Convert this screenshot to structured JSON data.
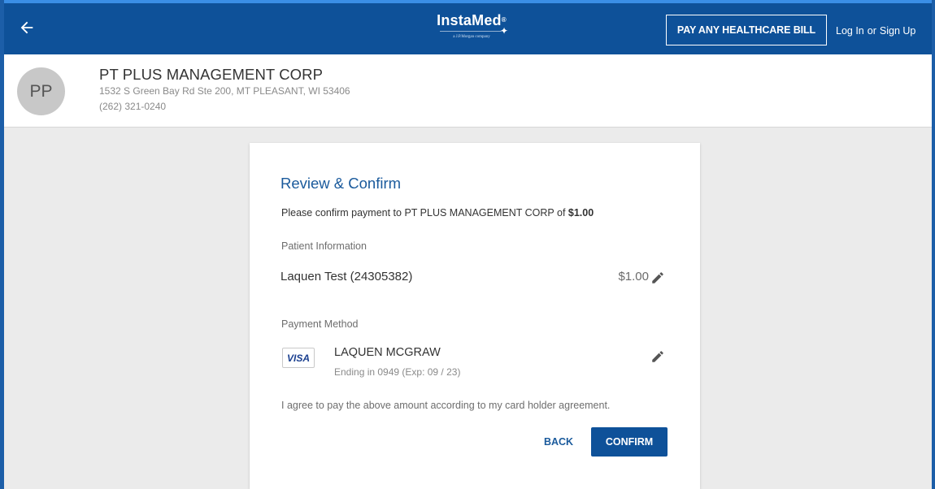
{
  "header": {
    "back_icon": "arrow-left-icon",
    "logo": {
      "name": "InstaMed",
      "tm": "®",
      "tagline": "a J.P.Morgan company"
    },
    "pay_bill_label": "PAY ANY HEALTHCARE BILL",
    "login_label": "Log In",
    "or_label": "or",
    "signup_label": "Sign Up"
  },
  "merchant": {
    "initials": "PP",
    "name": "PT PLUS MANAGEMENT CORP",
    "address": "1532 S Green Bay Rd Ste 200, MT PLEASANT, WI 53406",
    "phone": "(262) 321-0240"
  },
  "review": {
    "title": "Review & Confirm",
    "confirm_prefix": "Please confirm payment to PT PLUS MANAGEMENT CORP of ",
    "confirm_amount": "$1.00",
    "patient_section_label": "Patient Information",
    "patient_name": "Laquen Test (24305382)",
    "patient_amount": "$1.00",
    "payment_section_label": "Payment Method",
    "card_brand": "VISA",
    "card_holder": "LAQUEN MCGRAW",
    "card_ending": "Ending in 0949 (Exp: 09 / 23)",
    "agreement": "I agree to pay the above amount according to my card holder agreement.",
    "back_label": "BACK",
    "confirm_label": "CONFIRM",
    "edit_icon": "pencil-icon"
  },
  "colors": {
    "brand_blue": "#0e5199",
    "title_blue": "#1a5a9c",
    "background": "#ebebeb"
  }
}
